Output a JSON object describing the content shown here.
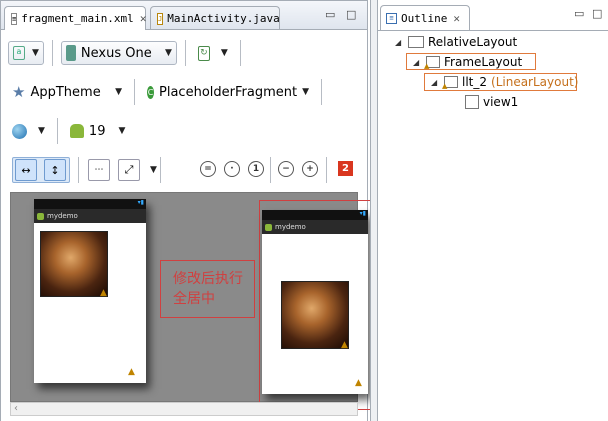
{
  "editor": {
    "tabs": [
      {
        "label": "fragment_main.xml",
        "close": "✕",
        "icon": "xml-file-icon"
      },
      {
        "label": "MainActivity.java",
        "icon": "java-file-icon"
      }
    ],
    "window_controls": [
      "▭",
      "□"
    ],
    "toolbar": {
      "device": "Nexus One",
      "theme": "AppTheme",
      "activity": "PlaceholderFragment",
      "api_level": "19",
      "error_count": "2"
    },
    "preview_left": {
      "app_title": "mydemo"
    },
    "preview_right": {
      "app_title": "mydemo"
    },
    "annotation": {
      "line1": "修改后执行",
      "line2": "全居中"
    },
    "scroll_left": "‹"
  },
  "outline": {
    "tab_label": "Outline",
    "close": "✕",
    "window_controls": [
      "▭",
      "□"
    ],
    "tree": [
      {
        "label": "RelativeLayout",
        "sublabel": ""
      },
      {
        "label": "FrameLayout",
        "sublabel": ""
      },
      {
        "label": "llt_2",
        "sublabel": "(LinearLayout)"
      },
      {
        "label": "view1",
        "sublabel": ""
      }
    ]
  },
  "colors": {
    "accent": "#e07a3c",
    "annotation": "#d04040",
    "error": "#d9361f"
  }
}
